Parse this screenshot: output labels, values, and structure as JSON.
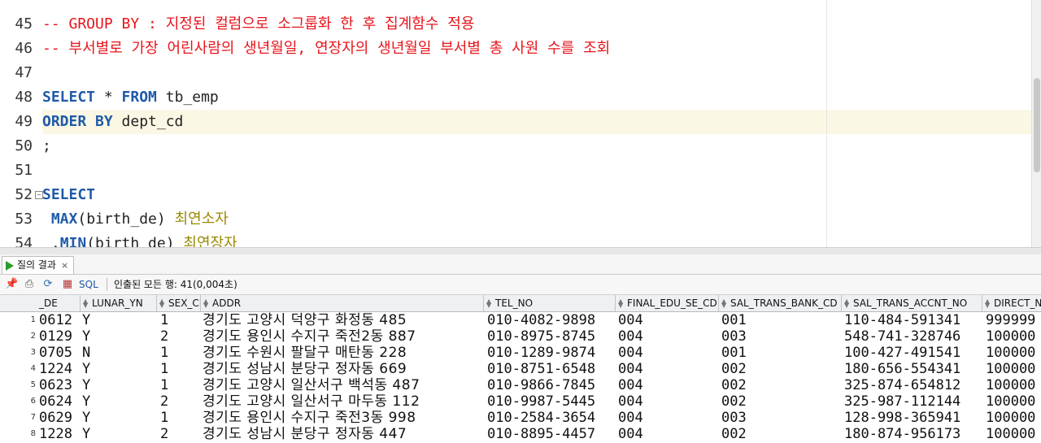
{
  "editor": {
    "lines": [
      {
        "num": "45",
        "segments": [
          {
            "cls": "cmt",
            "text": "-- GROUP BY : 지정된 컬럼으로 소그룹화 한 후 집계함수 적용"
          }
        ]
      },
      {
        "num": "46",
        "segments": [
          {
            "cls": "cmt",
            "text": "-- 부서별로 가장 어린사람의 생년월일, 연장자의 생년월일 부서별 총 사원 수를 조회"
          }
        ]
      },
      {
        "num": "47",
        "segments": []
      },
      {
        "num": "48",
        "segments": [
          {
            "cls": "kw",
            "text": "SELECT"
          },
          {
            "cls": "txt",
            "text": " * "
          },
          {
            "cls": "kw",
            "text": "FROM"
          },
          {
            "cls": "txt",
            "text": " tb_emp"
          }
        ]
      },
      {
        "num": "49",
        "segments": [
          {
            "cls": "kw",
            "text": "ORDER BY"
          },
          {
            "cls": "txt",
            "text": " dept_cd"
          }
        ]
      },
      {
        "num": "50",
        "segments": [
          {
            "cls": "txt",
            "text": ";"
          }
        ]
      },
      {
        "num": "51",
        "segments": []
      },
      {
        "num": "52",
        "segments": [
          {
            "cls": "kw",
            "text": "SELECT"
          }
        ]
      },
      {
        "num": "53",
        "segments": [
          {
            "cls": "fn",
            "text": " MAX"
          },
          {
            "cls": "txt",
            "text": "(birth_de) "
          },
          {
            "cls": "alias",
            "text": "최연소자"
          }
        ]
      },
      {
        "num": "54",
        "segments": [
          {
            "cls": "txt",
            "text": " ,"
          },
          {
            "cls": "fn",
            "text": "MIN"
          },
          {
            "cls": "txt",
            "text": "(birth_de) "
          },
          {
            "cls": "alias",
            "text": "최연장자"
          }
        ]
      }
    ]
  },
  "results": {
    "tab_label": "질의 결과",
    "tab_close": "×",
    "sql_label": "SQL",
    "status": "인출된 모든 행: 41(0,004초)",
    "columns": [
      "_DE",
      "LUNAR_YN",
      "SEX_CD",
      "ADDR",
      "TEL_NO",
      "FINAL_EDU_SE_CD",
      "SAL_TRANS_BANK_CD",
      "SAL_TRANS_ACCNT_NO",
      "DIRECT_N"
    ],
    "rows": [
      {
        "n": "1",
        "cells": [
          "0612",
          "Y",
          "1",
          "경기도 고양시 덕양구 화정동 485",
          "010-4082-9898",
          "004",
          "001",
          "110-484-591341",
          "999999"
        ]
      },
      {
        "n": "2",
        "cells": [
          "0129",
          "Y",
          "2",
          "경기도 용인시 수지구 죽전2동 887",
          "010-8975-8745",
          "004",
          "003",
          "548-741-328746",
          "100000"
        ]
      },
      {
        "n": "3",
        "cells": [
          "0705",
          "N",
          "1",
          "경기도 수원시 팔달구 매탄동 228",
          "010-1289-9874",
          "004",
          "001",
          "100-427-491541",
          "100000"
        ]
      },
      {
        "n": "4",
        "cells": [
          "1224",
          "Y",
          "1",
          "경기도 성남시 분당구 정자동 669",
          "010-8751-6548",
          "004",
          "002",
          "180-656-554341",
          "100000"
        ]
      },
      {
        "n": "5",
        "cells": [
          "0623",
          "Y",
          "1",
          "경기도 고양시 일산서구 백석동 487",
          "010-9866-7845",
          "004",
          "002",
          "325-874-654812",
          "100000"
        ]
      },
      {
        "n": "6",
        "cells": [
          "0624",
          "Y",
          "2",
          "경기도 고양시 일산서구 마두동 112",
          "010-9987-5445",
          "004",
          "002",
          "325-987-112144",
          "100000"
        ]
      },
      {
        "n": "7",
        "cells": [
          "0629",
          "Y",
          "1",
          "경기도 용인시 수지구 죽전3동 998",
          "010-2584-3654",
          "004",
          "003",
          "128-998-365941",
          "100000"
        ]
      },
      {
        "n": "8",
        "cells": [
          "1228",
          "Y",
          "2",
          "경기도 성남시 분당구 정자동 447",
          "010-8895-4457",
          "004",
          "002",
          "180-874-956173",
          "100000"
        ]
      }
    ]
  }
}
